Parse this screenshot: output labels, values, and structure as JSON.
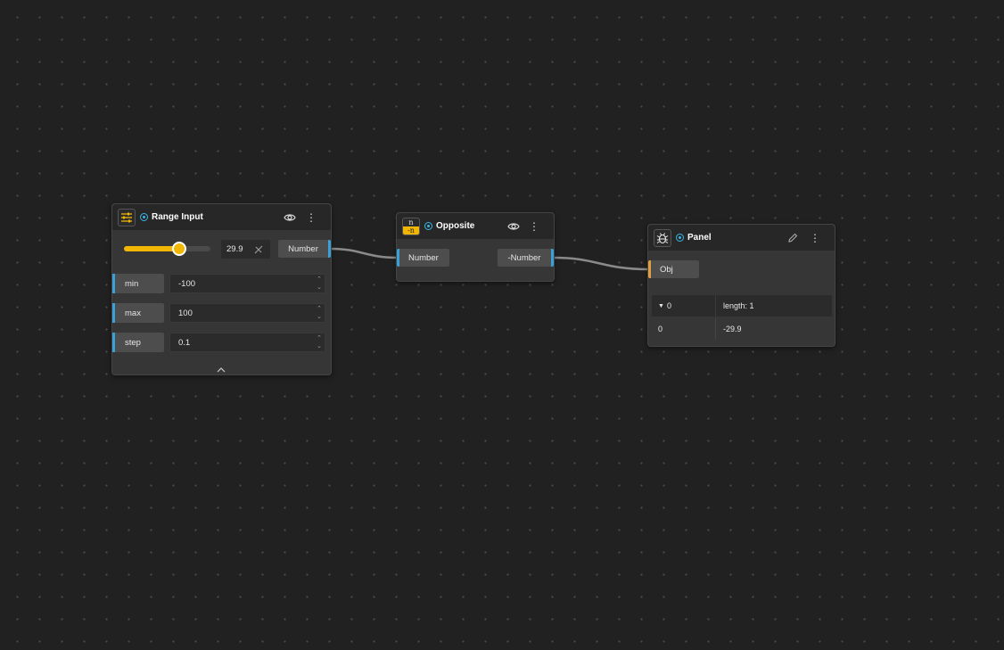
{
  "range_input": {
    "title": "Range Input",
    "value_display": "29.9",
    "slider_fraction": 0.649,
    "output_label": "Number",
    "fields": [
      {
        "label": "min",
        "value": "-100"
      },
      {
        "label": "max",
        "value": "100"
      },
      {
        "label": "step",
        "value": "0.1"
      }
    ]
  },
  "opposite": {
    "title": "Opposite",
    "icon_top": "n",
    "icon_bottom": "-n",
    "input_label": "Number",
    "output_label": "-Number"
  },
  "panel": {
    "title": "Panel",
    "input_label": "Obj",
    "table": {
      "header_key": "0",
      "header_value": "length: 1",
      "rows": [
        {
          "key": "0",
          "value": "-29.9"
        }
      ]
    }
  },
  "colors": {
    "accent_yellow": "#f2b705",
    "port_blue": "#3b9fd8",
    "port_orange": "#e0a040",
    "status_blue": "#3ab6e6"
  }
}
